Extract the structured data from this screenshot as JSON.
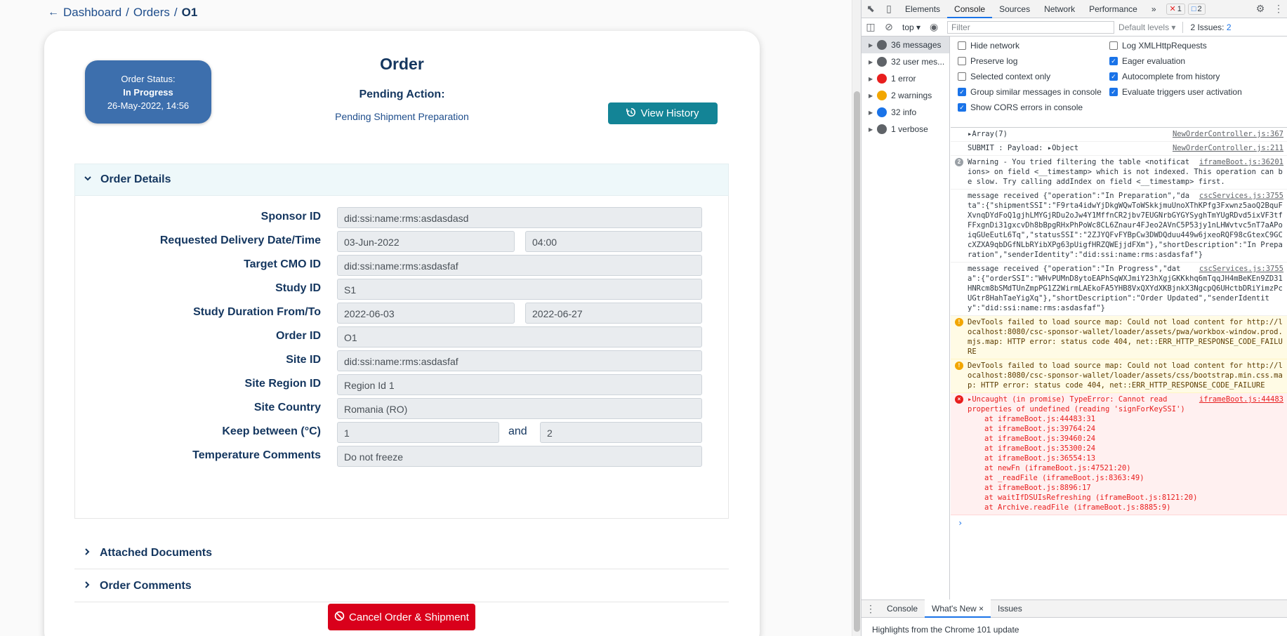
{
  "breadcrumb": {
    "dashboard": "Dashboard",
    "sep1": "/",
    "orders": "Orders",
    "sep2": "/",
    "current": "O1"
  },
  "header": {
    "title": "Order",
    "status": {
      "label": "Order Status:",
      "value": "In Progress",
      "date": "26-May-2022, 14:56"
    },
    "pending_label": "Pending Action:",
    "pending_value": "Pending Shipment Preparation",
    "history_button": "View History"
  },
  "sections": {
    "details": "Order Details",
    "attached": "Attached Documents",
    "comments": "Order Comments"
  },
  "fields": {
    "sponsor_id": {
      "label": "Sponsor ID",
      "value": "did:ssi:name:rms:asdasdasd"
    },
    "delivery": {
      "label": "Requested Delivery Date/Time",
      "date": "03-Jun-2022",
      "time": "04:00"
    },
    "target_cmo": {
      "label": "Target CMO ID",
      "value": "did:ssi:name:rms:asdasfaf"
    },
    "study_id": {
      "label": "Study ID",
      "value": "S1"
    },
    "study_duration": {
      "label": "Study Duration From/To",
      "from": "2022-06-03",
      "to": "2022-06-27"
    },
    "order_id": {
      "label": "Order ID",
      "value": "O1"
    },
    "site_id": {
      "label": "Site ID",
      "value": "did:ssi:name:rms:asdasfaf"
    },
    "site_region": {
      "label": "Site Region ID",
      "value": "Region Id 1"
    },
    "site_country": {
      "label": "Site Country",
      "value": "Romania (RO)"
    },
    "keep_between": {
      "label": "Keep between (°C)",
      "min": "1",
      "and": "and",
      "max": "2"
    },
    "temp_comments": {
      "label": "Temperature Comments",
      "value": "Do not freeze"
    }
  },
  "cancel_button": "Cancel Order & Shipment",
  "devtools": {
    "tabs": [
      "Elements",
      "Console",
      "Sources",
      "Network",
      "Performance"
    ],
    "more": "»",
    "error_count": "1",
    "info_count": "2",
    "context": "top",
    "filter_placeholder": "Filter",
    "levels": "Default levels",
    "issues": "2 Issues:",
    "issues_count": "2",
    "sidebar": [
      {
        "label": "36 messages",
        "icon": "list-icon",
        "color": "#5f6368"
      },
      {
        "label": "32 user mes...",
        "icon": "user-icon",
        "color": "#5f6368"
      },
      {
        "label": "1 error",
        "icon": "error-icon",
        "color": "#e81e1e"
      },
      {
        "label": "2 warnings",
        "icon": "warning-icon",
        "color": "#f2a600"
      },
      {
        "label": "32 info",
        "icon": "info-icon",
        "color": "#1a73e8"
      },
      {
        "label": "1 verbose",
        "icon": "verbose-icon",
        "color": "#5f6368"
      }
    ],
    "settings_left": [
      {
        "label": "Hide network",
        "checked": false
      },
      {
        "label": "Preserve log",
        "checked": false
      },
      {
        "label": "Selected context only",
        "checked": false
      },
      {
        "label": "Group similar messages in console",
        "checked": true
      },
      {
        "label": "Show CORS errors in console",
        "checked": true
      }
    ],
    "settings_right": [
      {
        "label": "Log XMLHttpRequests",
        "checked": false
      },
      {
        "label": "Eager evaluation",
        "checked": true
      },
      {
        "label": "Autocomplete from history",
        "checked": true
      },
      {
        "label": "Evaluate triggers user activation",
        "checked": true
      }
    ],
    "messages": [
      {
        "type": "log",
        "text": "▸Array(7)",
        "src": "NewOrderController.js:367"
      },
      {
        "type": "log",
        "text": "SUBMIT : Payload: ▸Object",
        "src": "NewOrderController.js:211"
      },
      {
        "type": "group",
        "count": "2",
        "text": "Warning - You tried filtering the table <notifications> on field <__timestamp> which is not indexed. This operation can be slow. Try calling addIndex on field <__timestamp> first.",
        "src": "iframeBoot.js:36201"
      },
      {
        "type": "log",
        "text": "message received {\"operation\":\"In Preparation\",\"data\":{\"shipmentSSI\":\"F9rta4idwYjDkgWQwToWSkkjmuUnoXThKPfg3Fxwnz5aoQ2BquFXvnqDYdFoQ1gjhLMYGjRDu2oJw4Y1MffnCR2jbv7EUGNrbGYGYSyghTmYUgRDvd5ixVF3tfFFxgnDi31gxcvDh8bBpgRHxPhPoWc8CL6Znaur4FJeo2AVnC5P53jy1nLHWvtvc5nT7aAPoiqGUeEutL6Tq\",\"statusSSI\":\"2ZJYQFvFYBpCw3DWDQduu449w6jxeoRQF98cGtexC9GCcXZXA9qbDGfNLbRYibXPg63pUigfHRZQWEjjdFXm\"},\"shortDescription\":\"In Preparation\",\"senderIdentity\":\"did:ssi:name:rms:asdasfaf\"}",
        "src": "cscServices.js:3755"
      },
      {
        "type": "log",
        "text": "message received {\"operation\":\"In Progress\",\"data\":{\"orderSSI\":\"WHvPUMnD8ytoEAPhSqWXJmiY23hXgjGKKkhq6mTqqJH4mBeKEn9ZD31HNRcm8bSMdTUnZmpPG1Z2WirmLAEkoFA5YHB8VxQXYdXKBjnkX3NgcpQ6UHctbDRiYimzPcUGtr8HahTaeYigXq\"},\"shortDescription\":\"Order Updated\",\"senderIdentity\":\"did:ssi:name:rms:asdasfaf\"}",
        "src": "cscServices.js:3755"
      },
      {
        "type": "warn",
        "text": "DevTools failed to load source map: Could not load content for http://localhost:8080/csc-sponsor-wallet/loader/assets/pwa/workbox-window.prod.mjs.map: HTTP error: status code 404, net::ERR_HTTP_RESPONSE_CODE_FAILURE",
        "src": ""
      },
      {
        "type": "warn",
        "text": "DevTools failed to load source map: Could not load content for http://localhost:8080/csc-sponsor-wallet/loader/assets/css/bootstrap.min.css.map: HTTP error: status code 404, net::ERR_HTTP_RESPONSE_CODE_FAILURE",
        "src": ""
      }
    ],
    "error": {
      "head": "▸Uncaught (in promise) TypeError: Cannot read properties of undefined (reading 'signForKeySSI')",
      "src": "iframeBoot.js:44483",
      "stack": [
        "at iframeBoot.js:44483:31",
        "at iframeBoot.js:39764:24",
        "at iframeBoot.js:39460:24",
        "at iframeBoot.js:35300:24",
        "at iframeBoot.js:36554:13",
        "at newFn (iframeBoot.js:47521:20)",
        "at _readFile (iframeBoot.js:8363:49)",
        "at iframeBoot.js:8896:17",
        "at waitIfDSUIsRefreshing (iframeBoot.js:8121:20)",
        "at Archive.readFile (iframeBoot.js:8885:9)"
      ]
    },
    "prompt": "›",
    "drawer_tabs": [
      "Console",
      "What's New",
      "Issues"
    ],
    "drawer_close": "×",
    "highlights": "Highlights from the Chrome 101 update"
  }
}
